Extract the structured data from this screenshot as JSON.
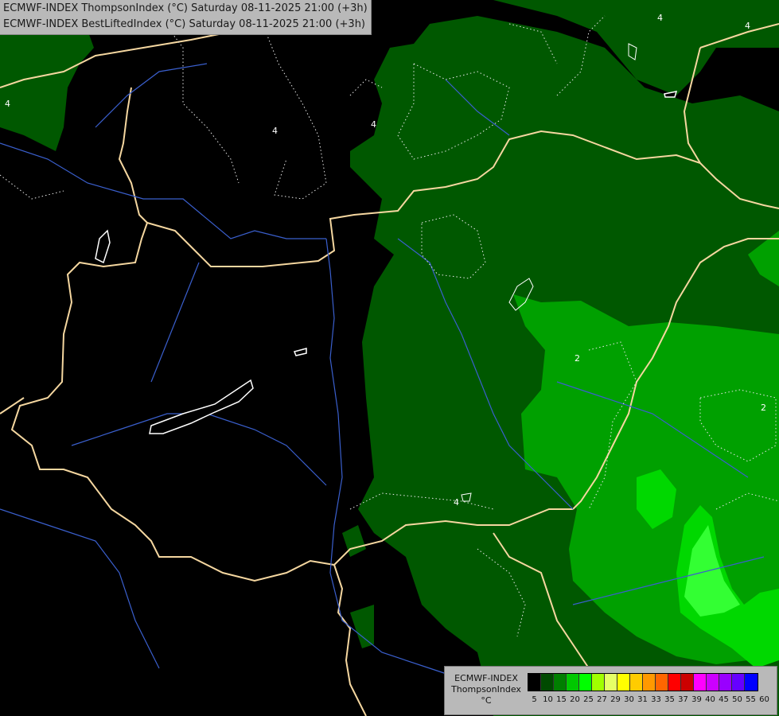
{
  "header": {
    "line1": "ECMWF-INDEX ThompsonIndex (°C) Saturday 08-11-2025 21:00 (+3h)",
    "line2": "ECMWF-INDEX BestLiftedIndex (°C) Saturday 08-11-2025 21:00 (+3h)"
  },
  "legend": {
    "label_line1": "ECMWF-INDEX",
    "label_line2": "ThompsonIndex",
    "label_line3": "°C",
    "colors": [
      "#000000",
      "#000000",
      "#000000",
      "#000000",
      "#004a00",
      "#007f00",
      "#00c800",
      "#00ff00",
      "#a0ff00",
      "#e6ff66",
      "#ffff00",
      "#ffcc00",
      "#ff9900",
      "#ff6600",
      "#ff0000",
      "#cc0000",
      "#ff00ff",
      "#cc00ff",
      "#9900ff",
      "#6600ff",
      "#0000ff"
    ],
    "ticks": [
      "5",
      "10",
      "15",
      "20",
      "25",
      "27",
      "29",
      "30",
      "31",
      "33",
      "35",
      "37",
      "39",
      "40",
      "45",
      "50",
      "55",
      "60"
    ]
  },
  "contour_labels": [
    "4",
    "4",
    "4",
    "4",
    "4",
    "2",
    "2",
    "4"
  ],
  "map_colors": {
    "background": "#000000",
    "dark_green": "#005800",
    "mid_green": "#00a000",
    "bright_green": "#00e000",
    "lime": "#22ff22",
    "border": "#f5d7a0",
    "river": "#3a5fcd"
  }
}
